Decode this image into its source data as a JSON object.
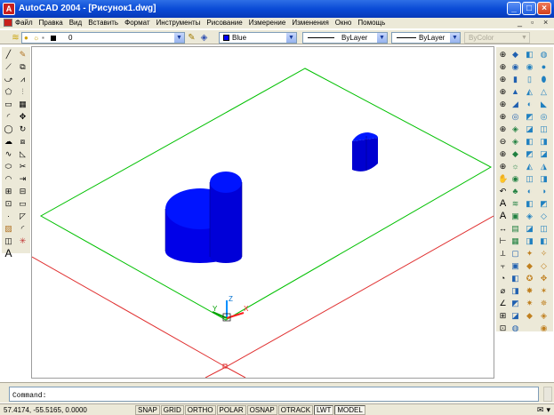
{
  "window": {
    "title": "AutoCAD 2004 - [Рисунок1.dwg]",
    "controls": [
      "minimize-icon",
      "maximize-icon",
      "close-icon"
    ]
  },
  "menu": {
    "items": [
      "Файл",
      "Правка",
      "Вид",
      "Вставить",
      "Формат",
      "Инструменты",
      "Рисование",
      "Измерение",
      "Изменения",
      "Окно",
      "Помощь"
    ],
    "doc_controls": [
      "_",
      "ᵐ",
      "×"
    ]
  },
  "layers_toolbar": {
    "layer_value": "0",
    "color_value": "Blue",
    "linetype_value": "ByLayer",
    "lineweight_value": "ByLayer",
    "plotstyle_value": "ByColor"
  },
  "colors": {
    "title_bar": "#0a4bd6",
    "chrome": "#ece9d8",
    "solid_blue": "#0000ff",
    "plane_green": "#00c000",
    "grid_red": "#e03030"
  },
  "ucs": {
    "x_label": "X",
    "y_label": "Y",
    "z_label": "Z"
  },
  "command": {
    "prompt": "Command:"
  },
  "status": {
    "coords": "57.4174, -55.5165, 0.0000",
    "toggles": [
      {
        "label": "SNAP",
        "on": false
      },
      {
        "label": "GRID",
        "on": false
      },
      {
        "label": "ORTHO",
        "on": false
      },
      {
        "label": "POLAR",
        "on": false
      },
      {
        "label": "OSNAP",
        "on": false
      },
      {
        "label": "OTRACK",
        "on": false
      },
      {
        "label": "LWT",
        "on": true
      },
      {
        "label": "MODEL",
        "on": true
      }
    ]
  }
}
